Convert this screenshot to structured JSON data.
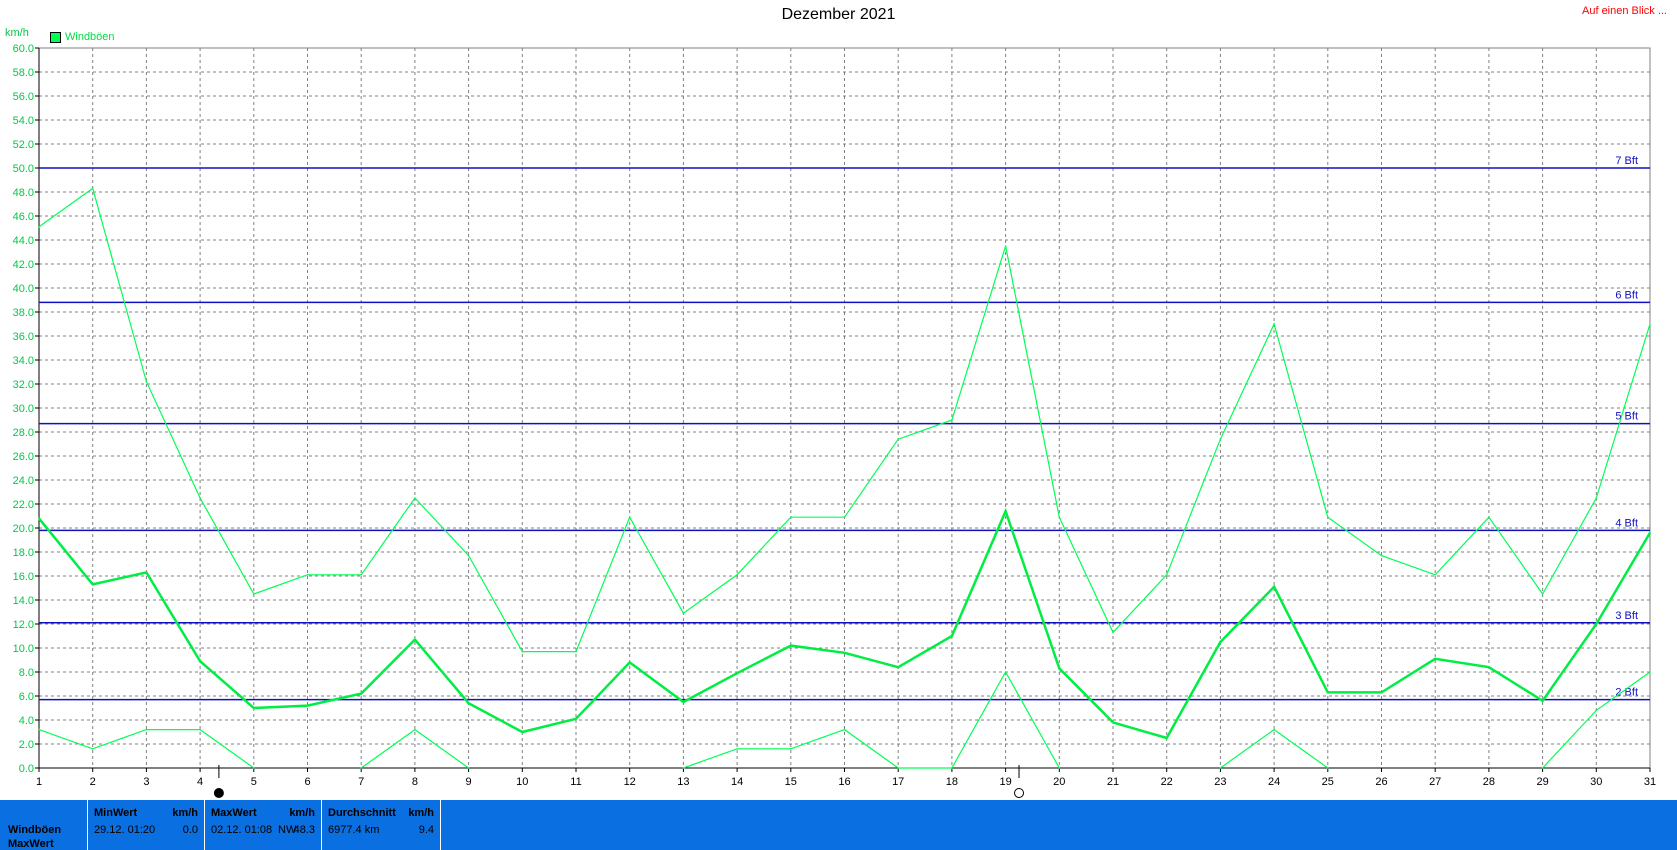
{
  "header": {
    "title": "Dezember 2021",
    "link": "Auf einen Blick ...",
    "unit": "km/h",
    "legend_label": "Windböen"
  },
  "chart_data": {
    "type": "line",
    "title": "Dezember 2021",
    "ylabel": "km/h",
    "ylim": [
      0,
      60
    ],
    "ytick_step": 2,
    "x": [
      1,
      2,
      3,
      4,
      5,
      6,
      7,
      8,
      9,
      10,
      11,
      12,
      13,
      14,
      15,
      16,
      17,
      18,
      19,
      20,
      21,
      22,
      23,
      24,
      25,
      26,
      27,
      28,
      29,
      30,
      31
    ],
    "grid": true,
    "legend": "top-left",
    "series": [
      {
        "name": "Windböen",
        "role": "max",
        "color": "#00ff55",
        "values": [
          45.1,
          48.3,
          32.2,
          22.5,
          14.5,
          16.1,
          16.1,
          22.5,
          17.7,
          9.7,
          9.7,
          20.9,
          12.9,
          16.1,
          20.9,
          20.9,
          27.4,
          29.0,
          43.5,
          20.9,
          11.3,
          16.1,
          27.4,
          37.0,
          20.9,
          17.7,
          16.1,
          20.9,
          14.5,
          22.5,
          37.0
        ]
      },
      {
        "name": "",
        "role": "avg",
        "color": "#00ee44",
        "values": [
          20.8,
          15.3,
          16.3,
          8.9,
          5.0,
          5.2,
          6.2,
          10.7,
          5.4,
          3.0,
          4.1,
          8.8,
          5.5,
          7.9,
          10.2,
          9.6,
          8.4,
          11.0,
          21.4,
          8.3,
          3.8,
          2.5,
          10.5,
          15.1,
          6.3,
          6.3,
          9.1,
          8.4,
          5.6,
          12.0,
          19.6
        ]
      },
      {
        "name": "",
        "role": "min",
        "color": "#00ff55",
        "values": [
          3.2,
          1.6,
          3.2,
          3.2,
          0.0,
          null,
          0.0,
          3.2,
          0.0,
          null,
          null,
          null,
          0.0,
          1.6,
          1.6,
          3.2,
          0.0,
          0.0,
          8.0,
          0.0,
          null,
          null,
          0.0,
          3.2,
          0.0,
          null,
          null,
          null,
          0.0,
          4.8,
          8.0
        ]
      }
    ],
    "reference_lines": [
      {
        "label": "7 Bft",
        "value": 50.0
      },
      {
        "label": "6 Bft",
        "value": 38.8
      },
      {
        "label": "5 Bft",
        "value": 28.7
      },
      {
        "label": "4 Bft",
        "value": 19.8
      },
      {
        "label": "3 Bft",
        "value": 12.1
      },
      {
        "label": "2 Bft",
        "value": 5.7
      }
    ],
    "markers": [
      {
        "x": 4.35,
        "symbol": "full-moon"
      },
      {
        "x": 19.25,
        "symbol": "new-moon"
      }
    ]
  },
  "footer": {
    "row_labels": [
      "Windböen",
      "MaxWert"
    ],
    "min": {
      "header": "MinWert",
      "unit": "km/h",
      "date": "29.12.  01:20",
      "value": "0.0"
    },
    "max": {
      "header": "MaxWert",
      "unit": "km/h",
      "date": "02.12.  01:08",
      "dir": "NW",
      "value": "48.3"
    },
    "avg": {
      "header": "Durchschnitt",
      "unit": "km/h",
      "distance": "6977.4 km",
      "value": "9.4"
    }
  },
  "colors": {
    "series": "#00ff55",
    "bft_lines": "#1010c0",
    "grid": "#808080",
    "footer_bg": "#0a6fe0",
    "link": "#ff0000"
  }
}
